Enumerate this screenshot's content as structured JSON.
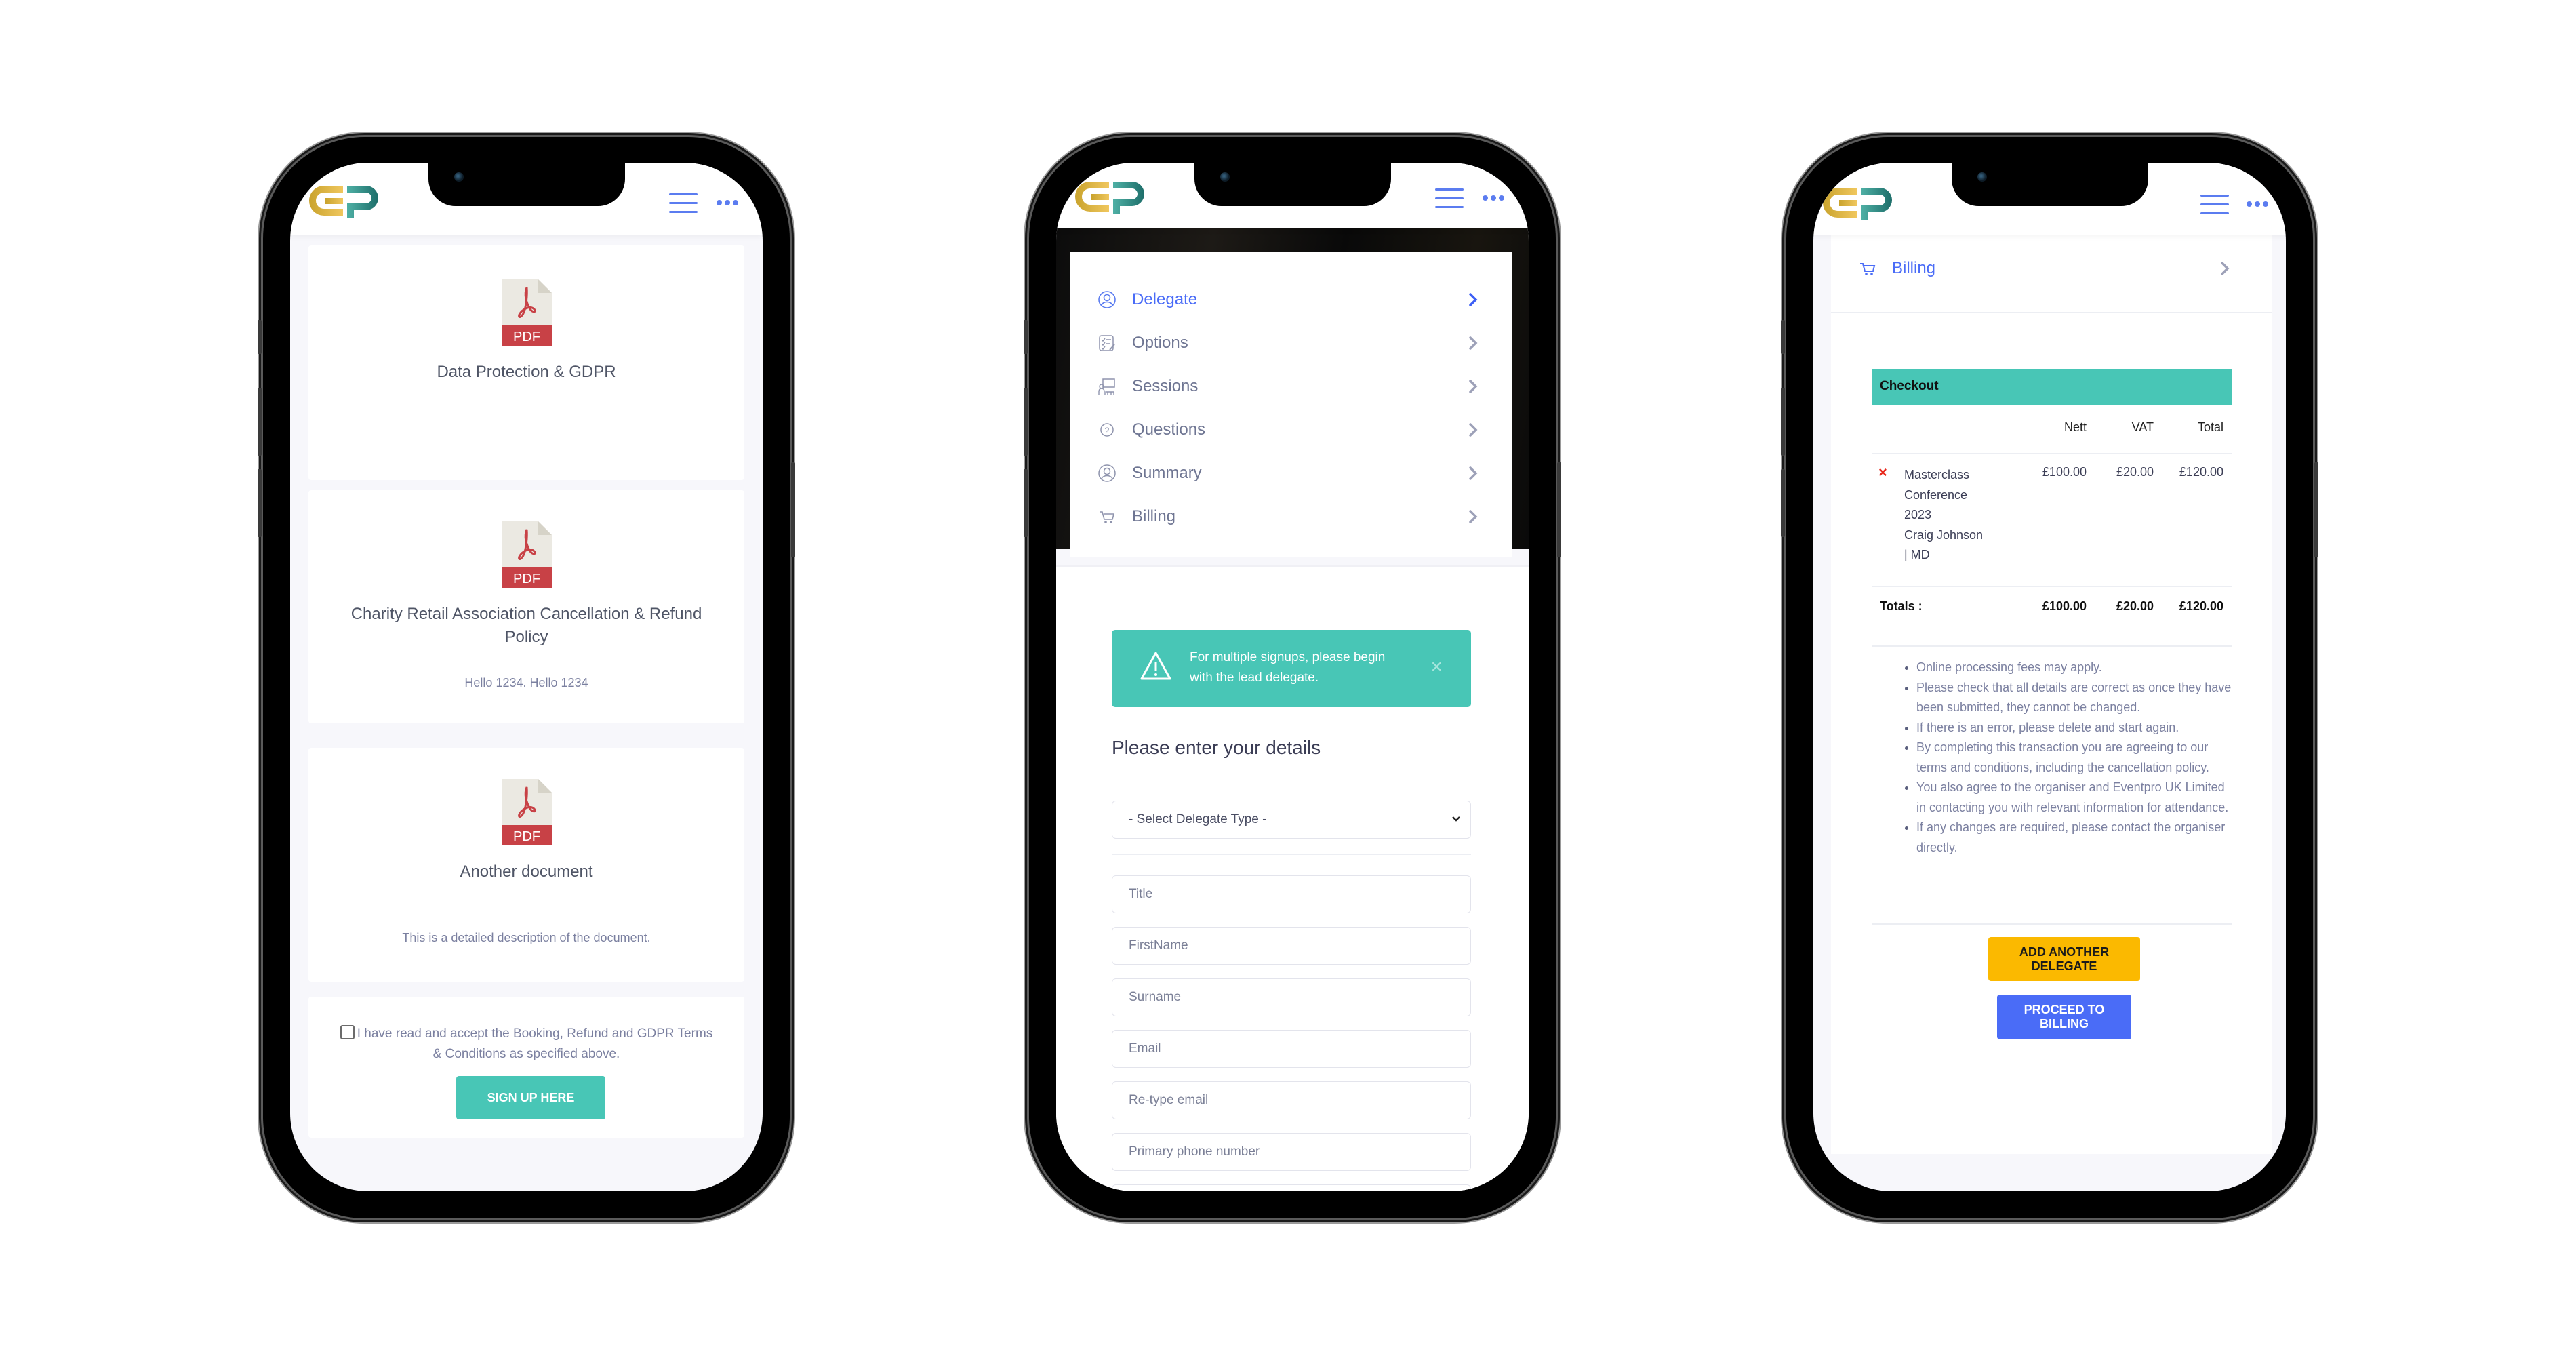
{
  "brand": {
    "logo_alt": "EP",
    "accent": "#4a6cf7",
    "teal": "#48c6b6",
    "gold": "#d7ae3a",
    "yellow": "#fbb900"
  },
  "header_icons": {
    "menu": "hamburger-icon",
    "more": "more-dots-icon"
  },
  "screen1": {
    "documents": [
      {
        "icon": "pdf-icon",
        "badge": "PDF",
        "title": "Data Protection & GDPR",
        "description": ""
      },
      {
        "icon": "pdf-icon",
        "badge": "PDF",
        "title": "Charity Retail Association Cancellation & Refund Policy",
        "description": "Hello 1234. Hello 1234"
      },
      {
        "icon": "pdf-icon",
        "badge": "PDF",
        "title": "Another document",
        "description": "This is a detailed description of the document."
      }
    ],
    "terms_label": "I have read and accept the Booking, Refund and GDPR Terms & Conditions as specified above.",
    "terms_checked": false,
    "signup_button": "SIGN UP HERE"
  },
  "screen2": {
    "menu": [
      {
        "label": "Delegate",
        "icon": "user-circle-icon",
        "active": true
      },
      {
        "label": "Options",
        "icon": "checklist-icon",
        "active": false
      },
      {
        "label": "Sessions",
        "icon": "sessions-icon",
        "active": false
      },
      {
        "label": "Questions",
        "icon": "question-circle-icon",
        "active": false
      },
      {
        "label": "Summary",
        "icon": "user-circle-icon",
        "active": false
      },
      {
        "label": "Billing",
        "icon": "cart-icon",
        "active": false
      }
    ],
    "alert": {
      "icon": "warning-icon",
      "text": "For multiple signups, please begin with the lead delegate.",
      "close": "×"
    },
    "section_title": "Please enter your details",
    "delegate_type_select": {
      "selected": "- Select Delegate Type -"
    },
    "fields": [
      {
        "name": "title",
        "placeholder": "Title",
        "value": ""
      },
      {
        "name": "firstname",
        "placeholder": "FirstName",
        "value": ""
      },
      {
        "name": "surname",
        "placeholder": "Surname",
        "value": ""
      },
      {
        "name": "email",
        "placeholder": "Email",
        "value": ""
      },
      {
        "name": "retype-email",
        "placeholder": "Re-type email",
        "value": ""
      },
      {
        "name": "primary-phone",
        "placeholder": "Primary phone number",
        "value": ""
      }
    ]
  },
  "screen3": {
    "billing_label": "Billing",
    "checkout": {
      "title": "Checkout",
      "columns": [
        "Nett",
        "VAT",
        "Total"
      ],
      "items": [
        {
          "remove_icon": "×",
          "lines": [
            "Masterclass",
            "Conference",
            "2023",
            "Craig Johnson",
            "| MD"
          ],
          "nett": "£100.00",
          "vat": "£20.00",
          "total": "£120.00"
        }
      ],
      "totals_label": "Totals :",
      "totals": {
        "nett": "£100.00",
        "vat": "£20.00",
        "total": "£120.00"
      }
    },
    "notes": [
      "Online processing fees may apply.",
      "Please check that all details are correct as once they have been submitted, they cannot be changed.",
      "If there is an error, please delete and start again.",
      "By completing this transaction you are agreeing to our terms and conditions, including the cancellation policy.",
      "You also agree to the organiser and Eventpro UK Limited in contacting you with relevant information for attendance.",
      "If any changes are required, please contact the organiser directly."
    ],
    "add_delegate_button": "ADD ANOTHER DELEGATE",
    "proceed_button": "PROCEED TO BILLING"
  }
}
